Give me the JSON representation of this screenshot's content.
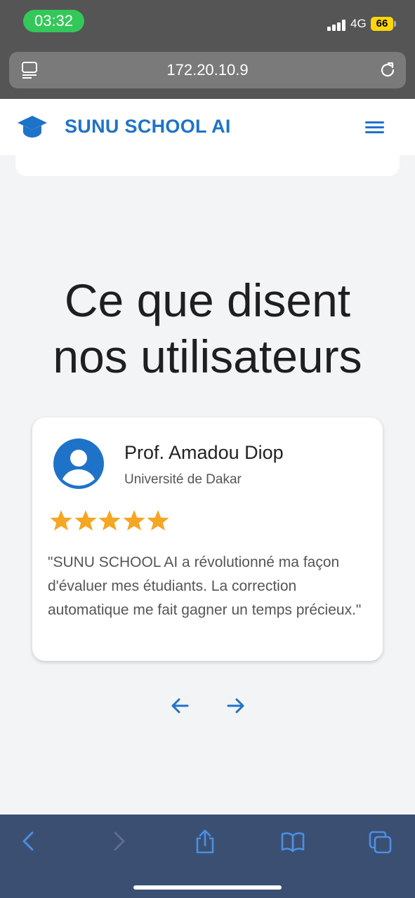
{
  "status_bar": {
    "time": "03:32",
    "network": "4G",
    "battery": "66"
  },
  "browser": {
    "url": "172.20.10.9"
  },
  "header": {
    "brand": "SUNU SCHOOL AI",
    "logo_icon": "graduation-cap-icon",
    "menu_icon": "hamburger-menu-icon"
  },
  "colors": {
    "accent": "#1e73c8",
    "star": "#f5a623",
    "status_green": "#34c759",
    "toolbar": "#3b4f73"
  },
  "section": {
    "title_line1": "Ce que disent",
    "title_line2": "nos utilisateurs"
  },
  "testimonial": {
    "name": "Prof. Amadou Diop",
    "affiliation": "Université de Dakar",
    "rating": 5,
    "quote": "\"SUNU SCHOOL AI a révolutionné ma façon d'évaluer mes étudiants. La correction automatique me fait gagner un temps précieux.\""
  },
  "carousel": {
    "prev_icon": "arrow-left-icon",
    "next_icon": "arrow-right-icon"
  },
  "toolbar": {
    "items": [
      "back-icon",
      "forward-icon",
      "share-icon",
      "bookmarks-icon",
      "tabs-icon"
    ]
  }
}
